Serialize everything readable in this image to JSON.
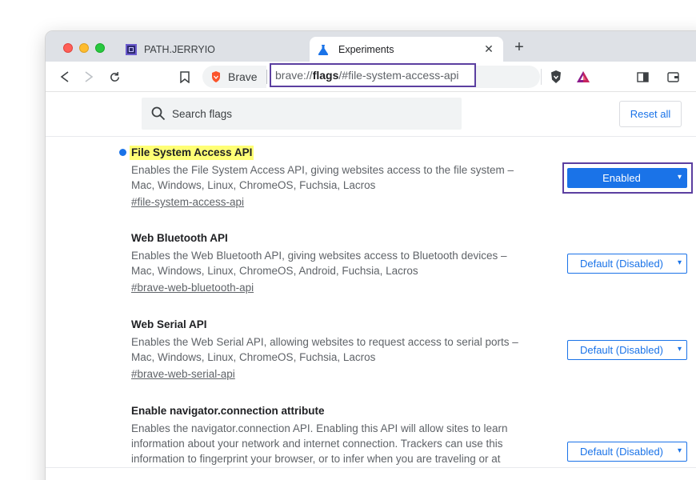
{
  "tabs": [
    {
      "title": "PATH.JERRYIO",
      "active": false
    },
    {
      "title": "Experiments",
      "active": true
    }
  ],
  "toolbar": {
    "browser_label": "Brave",
    "url_prefix": "brave://",
    "url_host": "flags",
    "url_fragment": "/#file-system-access-api"
  },
  "search": {
    "placeholder": "Search flags"
  },
  "reset_label": "Reset all",
  "flags": [
    {
      "title": "File System Access API",
      "desc1": "Enables the File System Access API, giving websites access to the file system –",
      "desc2": "Mac, Windows, Linux, ChromeOS, Fuchsia, Lacros",
      "link": "#file-system-access-api",
      "value": "Enabled"
    },
    {
      "title": "Web Bluetooth API",
      "desc1": "Enables the Web Bluetooth API, giving websites access to Bluetooth devices –",
      "desc2": "Mac, Windows, Linux, ChromeOS, Android, Fuchsia, Lacros",
      "link": "#brave-web-bluetooth-api",
      "value": "Default (Disabled)"
    },
    {
      "title": "Web Serial API",
      "desc1": "Enables the Web Serial API, allowing websites to request access to serial ports –",
      "desc2": "Mac, Windows, Linux, ChromeOS, Fuchsia, Lacros",
      "link": "#brave-web-serial-api",
      "value": "Default (Disabled)"
    },
    {
      "title": "Enable navigator.connection attribute",
      "desc1": "Enables the navigator.connection API. Enabling this API will allow sites to learn",
      "desc2": "information about your network and internet connection. Trackers can use this",
      "desc3": "information to fingerprint your browser, or to infer when you are traveling or at",
      "value": "Default (Disabled)"
    }
  ],
  "colors": {
    "accent": "#1a73e8",
    "highlight": "#ffff75",
    "annotation": "#5b3fa0"
  }
}
